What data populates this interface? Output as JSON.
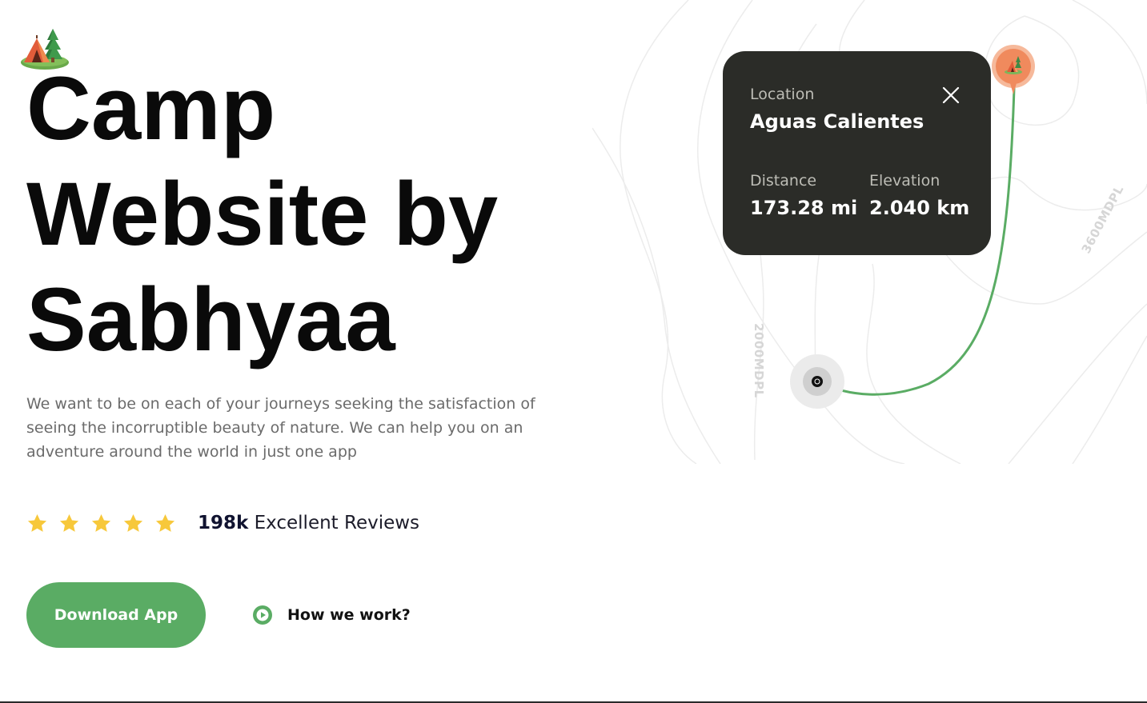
{
  "hero": {
    "logo_icon": "camp-tent-icon",
    "title_lines": [
      "Camp",
      "Website by",
      "Sabhyaa"
    ],
    "description": "We want to be on each of your journeys seeking the satisfaction of seeing the incorruptible beauty of nature. We can help you on an adventure around the world in just one app"
  },
  "rating": {
    "stars": 5,
    "star_icon": "star-icon",
    "star_color": "#f7c83b",
    "count": "198k",
    "label": "Excellent Reviews"
  },
  "actions": {
    "download_label": "Download App",
    "download_color": "#5aac64",
    "how_label": "How we work?",
    "how_icon": "play-icon"
  },
  "map": {
    "contour_labels": [
      "3600MDPL",
      "2000MDPL"
    ],
    "route_color": "#5aac64",
    "pin_color": "#f08a5d",
    "card": {
      "location_label": "Location",
      "location_value": "Aguas Calientes",
      "distance_label": "Distance",
      "distance_value": "173.28 mi",
      "elevation_label": "Elevation",
      "elevation_value": "2.040 km",
      "background": "#2b2c28"
    }
  }
}
